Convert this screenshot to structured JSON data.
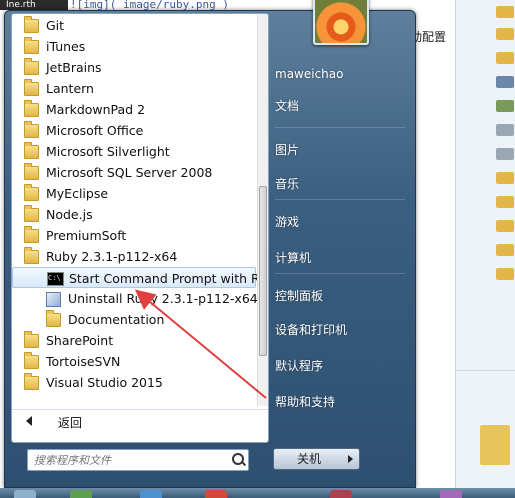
{
  "background": {
    "editor_tab": "Ine.rth",
    "code_line": "![img]( image/ruby.png )",
    "partial_text": "动配置"
  },
  "start_menu": {
    "programs": [
      {
        "label": "Git",
        "icon": "folder-icon",
        "indent": 0
      },
      {
        "label": "iTunes",
        "icon": "folder-icon",
        "indent": 0
      },
      {
        "label": "JetBrains",
        "icon": "folder-icon",
        "indent": 0
      },
      {
        "label": "Lantern",
        "icon": "folder-icon",
        "indent": 0
      },
      {
        "label": "MarkdownPad 2",
        "icon": "folder-icon",
        "indent": 0
      },
      {
        "label": "Microsoft Office",
        "icon": "folder-icon",
        "indent": 0
      },
      {
        "label": "Microsoft Silverlight",
        "icon": "folder-icon",
        "indent": 0
      },
      {
        "label": "Microsoft SQL Server 2008",
        "icon": "folder-icon",
        "indent": 0
      },
      {
        "label": "MyEclipse",
        "icon": "folder-icon",
        "indent": 0
      },
      {
        "label": "Node.js",
        "icon": "folder-icon",
        "indent": 0
      },
      {
        "label": "PremiumSoft",
        "icon": "folder-icon",
        "indent": 0
      },
      {
        "label": "Ruby 2.3.1-p112-x64",
        "icon": "folder-icon",
        "indent": 0
      },
      {
        "label": "Start Command Prompt with Ruby",
        "icon": "command-prompt-icon",
        "indent": 1,
        "selected": true
      },
      {
        "label": "Uninstall Ruby 2.3.1-p112-x64",
        "icon": "uninstall-icon",
        "indent": 1
      },
      {
        "label": "Documentation",
        "icon": "folder-icon",
        "indent": 1
      },
      {
        "label": "SharePoint",
        "icon": "folder-icon",
        "indent": 0
      },
      {
        "label": "TortoiseSVN",
        "icon": "folder-icon",
        "indent": 0
      },
      {
        "label": "Visual Studio 2015",
        "icon": "folder-icon",
        "indent": 0
      }
    ],
    "back_label": "返回",
    "search_placeholder": "搜索程序和文件",
    "user_name": "maweichao",
    "right_items": [
      {
        "label": "文档",
        "key": "documents"
      },
      {
        "label": "图片",
        "key": "pictures"
      },
      {
        "label": "音乐",
        "key": "music"
      },
      {
        "label": "游戏",
        "key": "games"
      },
      {
        "label": "计算机",
        "key": "computer"
      },
      {
        "label": "控制面板",
        "key": "control-panel"
      },
      {
        "label": "设备和打印机",
        "key": "devices-printers"
      },
      {
        "label": "默认程序",
        "key": "default-programs"
      },
      {
        "label": "帮助和支持",
        "key": "help-support"
      }
    ],
    "shutdown_label": "关机"
  },
  "colors": {
    "annotation_arrow": "#e04040",
    "menu_accent": "#3b5f80"
  }
}
